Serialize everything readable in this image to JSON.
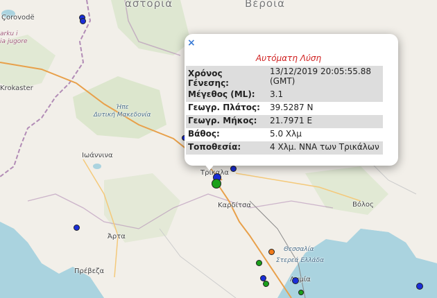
{
  "map": {
    "places": [
      {
        "id": "kastoria",
        "label": "αστοριά",
        "cls": "big"
      },
      {
        "id": "veroia",
        "label": "Βέροια",
        "cls": "big"
      },
      {
        "id": "corovode",
        "label": "Çorovodë",
        "cls": ""
      },
      {
        "id": "qarku",
        "label": "arku i",
        "cls": "region2"
      },
      {
        "id": "qarku2",
        "label": "ia jugore",
        "cls": "region2"
      },
      {
        "id": "krokaster",
        "label": "Krokaster",
        "cls": ""
      },
      {
        "id": "dytiki",
        "label": "Ήπε\nΔυτική Μακεδονία",
        "cls": "region"
      },
      {
        "id": "ioannina",
        "label": "Ιωάννινα",
        "cls": ""
      },
      {
        "id": "trikala",
        "label": "Τρίκαλα",
        "cls": ""
      },
      {
        "id": "karditsa",
        "label": "Καρδίτσα",
        "cls": ""
      },
      {
        "id": "volos",
        "label": "Βόλος",
        "cls": ""
      },
      {
        "id": "arta",
        "label": "Άρτα",
        "cls": ""
      },
      {
        "id": "preveza",
        "label": "Πρέβεζα",
        "cls": ""
      },
      {
        "id": "thessalia",
        "label": "Θεσσαλία",
        "cls": "region"
      },
      {
        "id": "sterea",
        "label": "Στερεά Ελλάδα",
        "cls": "region"
      },
      {
        "id": "lamia",
        "label": "Λαμία",
        "cls": ""
      }
    ],
    "markers": [
      {
        "id": "m1",
        "color": "#1a2ed8"
      },
      {
        "id": "m2",
        "color": "#1a2ed8"
      },
      {
        "id": "m3",
        "color": "#1a2ed8"
      },
      {
        "id": "m4",
        "color": "#1a2ed8"
      },
      {
        "id": "m5",
        "color": "#1a2ed8"
      },
      {
        "id": "m6",
        "color": "#1a2ed8"
      },
      {
        "id": "m7",
        "color": "#1a2ed8"
      },
      {
        "id": "m8",
        "color": "#1a2ed8"
      },
      {
        "id": "m9",
        "color": "#1a2ed8"
      },
      {
        "id": "m10",
        "color": "#1aa01a"
      },
      {
        "id": "m11",
        "color": "#1aa01a"
      },
      {
        "id": "m12",
        "color": "#1aa01a"
      },
      {
        "id": "m13",
        "color": "#f07a1a"
      },
      {
        "id": "m14",
        "color": "#1aa01a"
      }
    ]
  },
  "popup": {
    "close_label": "×",
    "title": "Αυτόματη Λύση",
    "rows": [
      {
        "key": "Χρόνος Γένεσης:",
        "value": "13/12/2019 20:05:55.88 (GMT)"
      },
      {
        "key": "Μέγεθος (ML):",
        "value": "3.1"
      },
      {
        "key": "Γεωγρ. Πλάτος:",
        "value": "39.5287 N"
      },
      {
        "key": "Γεωγρ. Μήκος:",
        "value": "21.7971 E"
      },
      {
        "key": "Βάθος:",
        "value": "5.0 Χλμ"
      },
      {
        "key": "Τοποθεσία:",
        "value": "4 Χλμ. ΝΝΑ των Τρικάλων"
      }
    ]
  }
}
